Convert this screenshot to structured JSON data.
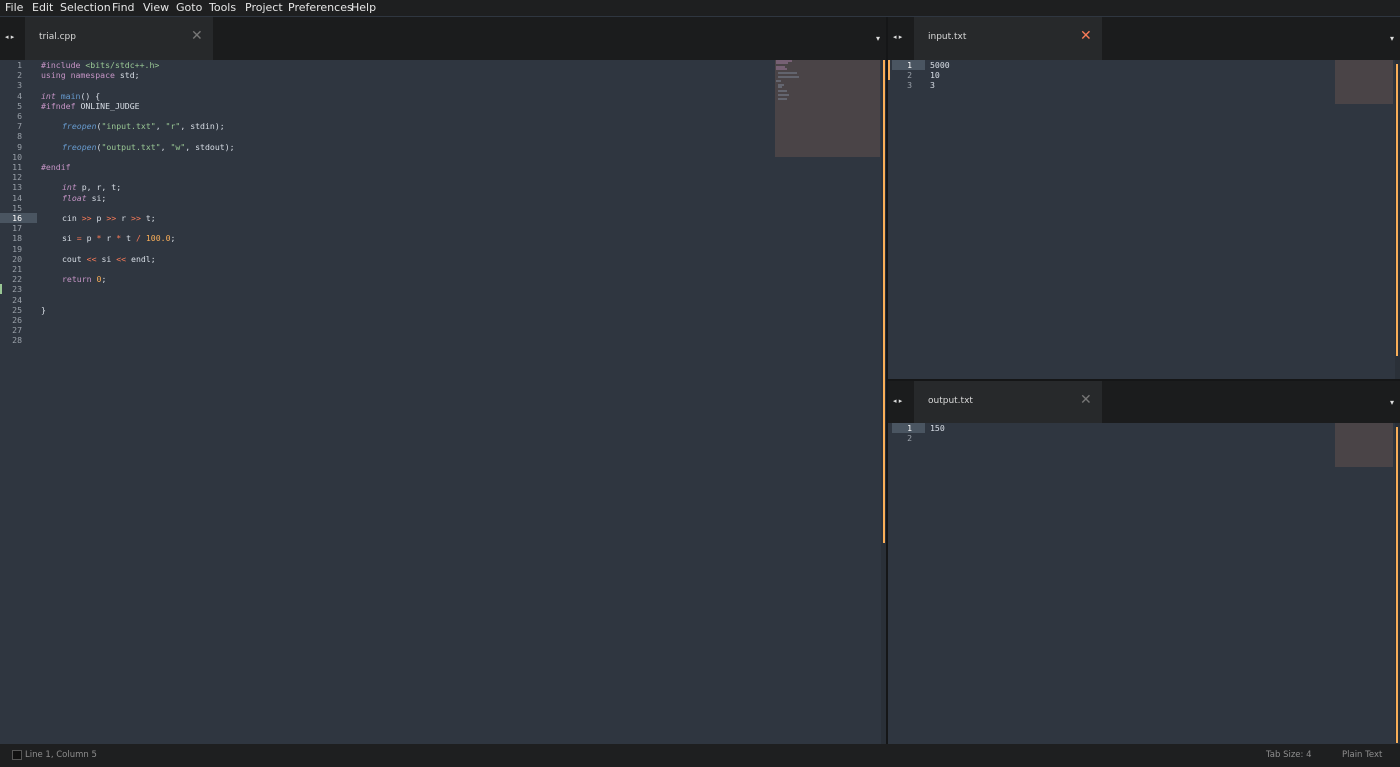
{
  "menu": [
    "File",
    "Edit",
    "Selection",
    "Find",
    "View",
    "Goto",
    "Tools",
    "Project",
    "Preferences",
    "Help"
  ],
  "left_pane": {
    "tab_label": "trial.cpp",
    "close_glyph": "✕",
    "line_numbers": [
      "1",
      "2",
      "3",
      "4",
      "5",
      "6",
      "7",
      "8",
      "9",
      "10",
      "11",
      "12",
      "13",
      "14",
      "15",
      "16",
      "17",
      "18",
      "19",
      "20",
      "21",
      "22",
      "23",
      "24",
      "25",
      "26",
      "27",
      "28"
    ],
    "current_line": "16",
    "code": {
      "l1a": "#include ",
      "l1b": "<bits/stdc++.h>",
      "l2a": "using ",
      "l2b": "namespace ",
      "l2c": "std;",
      "l4a": "int ",
      "l4b": "main",
      "l4c": "() {",
      "l5a": "#ifndef ",
      "l5b": "ONLINE_JUDGE",
      "l7a": "freopen",
      "l7b": "(",
      "l7c": "\"input.txt\"",
      ", ": ", ",
      "l7d": "\"r\"",
      "l7e": ", stdin);",
      "l9a": "freopen",
      "l9b": "(",
      "l9c": "\"output.txt\"",
      "l9d": "\"w\"",
      "l9e": ", stdout);",
      "l11": "#endif",
      "l13a": "int ",
      "l13b": "p, r, t;",
      "l14a": "float ",
      "l14b": "si;",
      "l16a": "cin ",
      "l16b": ">>",
      "l16c": " p ",
      "l16d": ">>",
      "l16e": " r ",
      "l16f": ">>",
      "l16g": " t;",
      "l18a": "si ",
      "l18b": "=",
      "l18c": " p ",
      "l18d": "*",
      "l18e": " r ",
      "l18f": "*",
      "l18g": " t ",
      "l18h": "/",
      "l18i": " ",
      "l18j": "100.0",
      ";": ";",
      "l20a": "cout ",
      "l20b": "<<",
      "l20c": " si ",
      "l20d": "<<",
      "l20e": " endl;",
      "l22a": "return ",
      "l22b": "0",
      "l25": "}"
    }
  },
  "right_top_pane": {
    "tab_label": "input.txt",
    "close_glyph": "✕",
    "line_numbers": [
      "1",
      "2",
      "3"
    ],
    "lines": [
      "5000",
      "10",
      "3"
    ]
  },
  "right_bottom_pane": {
    "tab_label": "output.txt",
    "close_glyph": "✕",
    "line_numbers": [
      "1",
      "2"
    ],
    "lines": [
      "150"
    ]
  },
  "nav_arrows": "◂ ▸",
  "dropdown_glyph": "▾",
  "status": {
    "position": "Line 1, Column 5",
    "tab_size": "Tab Size: 4",
    "syntax": "Plain Text"
  },
  "colors": {
    "background": "#2f3640",
    "keyword": "#c594c5",
    "function": "#6699cc",
    "string": "#99c794",
    "operator": "#f97b58",
    "number": "#f9ae58",
    "close_active": "#f97b58"
  }
}
